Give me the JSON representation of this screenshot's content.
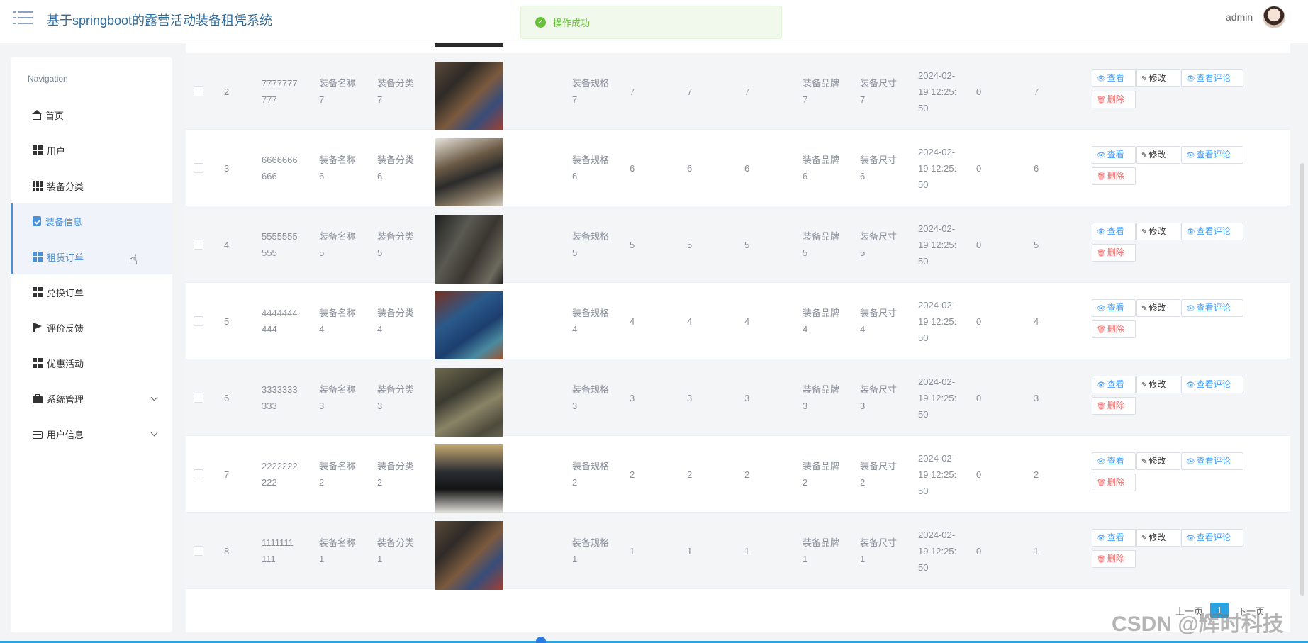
{
  "header": {
    "title": "基于springboot的露营活动装备租凭系统",
    "user": "admin"
  },
  "toast": {
    "message": "操作成功",
    "icon": "check-circle-icon",
    "color": "#67c23a"
  },
  "sidebar": {
    "heading": "Navigation",
    "items": [
      {
        "label": "首页",
        "icon": "home-icon"
      },
      {
        "label": "用户",
        "icon": "grid-icon"
      },
      {
        "label": "装备分类",
        "icon": "grid9-icon"
      },
      {
        "label": "装备信息",
        "icon": "clipboard-icon"
      },
      {
        "label": "租赁订单",
        "icon": "grid-icon"
      },
      {
        "label": "兑换订单",
        "icon": "grid-icon"
      },
      {
        "label": "评价反馈",
        "icon": "flag-icon"
      },
      {
        "label": "优惠活动",
        "icon": "grid-icon"
      },
      {
        "label": "系统管理",
        "icon": "briefcase-icon"
      },
      {
        "label": "用户信息",
        "icon": "card-icon"
      }
    ]
  },
  "actions": {
    "view": "查看",
    "edit": "修改",
    "review": "查看评论",
    "delete": "删除"
  },
  "rows": [
    {
      "idx": "2",
      "code": [
        "7777777",
        "777"
      ],
      "name": [
        "装备名称",
        "7"
      ],
      "cat": [
        "装备分类",
        "7"
      ],
      "spec": [
        "装备规格",
        "7"
      ],
      "n1": "7",
      "n2": "7",
      "n3": "7",
      "brand": [
        "装备品牌",
        "7"
      ],
      "size": [
        "装备尺寸",
        "7"
      ],
      "time": [
        "2024-02-",
        "19 12:25:",
        "50"
      ],
      "zero": "0",
      "n4": "7"
    },
    {
      "idx": "3",
      "code": [
        "6666666",
        "666"
      ],
      "name": [
        "装备名称",
        "6"
      ],
      "cat": [
        "装备分类",
        "6"
      ],
      "spec": [
        "装备规格",
        "6"
      ],
      "n1": "6",
      "n2": "6",
      "n3": "6",
      "brand": [
        "装备品牌",
        "6"
      ],
      "size": [
        "装备尺寸",
        "6"
      ],
      "time": [
        "2024-02-",
        "19 12:25:",
        "50"
      ],
      "zero": "0",
      "n4": "6"
    },
    {
      "idx": "4",
      "code": [
        "5555555",
        "555"
      ],
      "name": [
        "装备名称",
        "5"
      ],
      "cat": [
        "装备分类",
        "5"
      ],
      "spec": [
        "装备规格",
        "5"
      ],
      "n1": "5",
      "n2": "5",
      "n3": "5",
      "brand": [
        "装备品牌",
        "5"
      ],
      "size": [
        "装备尺寸",
        "5"
      ],
      "time": [
        "2024-02-",
        "19 12:25:",
        "50"
      ],
      "zero": "0",
      "n4": "5"
    },
    {
      "idx": "5",
      "code": [
        "4444444",
        "444"
      ],
      "name": [
        "装备名称",
        "4"
      ],
      "cat": [
        "装备分类",
        "4"
      ],
      "spec": [
        "装备规格",
        "4"
      ],
      "n1": "4",
      "n2": "4",
      "n3": "4",
      "brand": [
        "装备品牌",
        "4"
      ],
      "size": [
        "装备尺寸",
        "4"
      ],
      "time": [
        "2024-02-",
        "19 12:25:",
        "50"
      ],
      "zero": "0",
      "n4": "4"
    },
    {
      "idx": "6",
      "code": [
        "3333333",
        "333"
      ],
      "name": [
        "装备名称",
        "3"
      ],
      "cat": [
        "装备分类",
        "3"
      ],
      "spec": [
        "装备规格",
        "3"
      ],
      "n1": "3",
      "n2": "3",
      "n3": "3",
      "brand": [
        "装备品牌",
        "3"
      ],
      "size": [
        "装备尺寸",
        "3"
      ],
      "time": [
        "2024-02-",
        "19 12:25:",
        "50"
      ],
      "zero": "0",
      "n4": "3"
    },
    {
      "idx": "7",
      "code": [
        "2222222",
        "222"
      ],
      "name": [
        "装备名称",
        "2"
      ],
      "cat": [
        "装备分类",
        "2"
      ],
      "spec": [
        "装备规格",
        "2"
      ],
      "n1": "2",
      "n2": "2",
      "n3": "2",
      "brand": [
        "装备品牌",
        "2"
      ],
      "size": [
        "装备尺寸",
        "2"
      ],
      "time": [
        "2024-02-",
        "19 12:25:",
        "50"
      ],
      "zero": "0",
      "n4": "2"
    },
    {
      "idx": "8",
      "code": [
        "1111111",
        "111"
      ],
      "name": [
        "装备名称",
        "1"
      ],
      "cat": [
        "装备分类",
        "1"
      ],
      "spec": [
        "装备规格",
        "1"
      ],
      "n1": "1",
      "n2": "1",
      "n3": "1",
      "brand": [
        "装备品牌",
        "1"
      ],
      "size": [
        "装备尺寸",
        "1"
      ],
      "time": [
        "2024-02-",
        "19 12:25:",
        "50"
      ],
      "zero": "0",
      "n4": "1"
    }
  ],
  "pagination": {
    "prev": "上一页",
    "current": "1",
    "next": "下一页"
  },
  "watermark": "CSDN @辉时科技",
  "colors": {
    "accent": "#4a90d9",
    "success": "#67c23a",
    "danger": "#f56c6c",
    "primary": "#409eff",
    "pager": "#2aa3e0"
  }
}
